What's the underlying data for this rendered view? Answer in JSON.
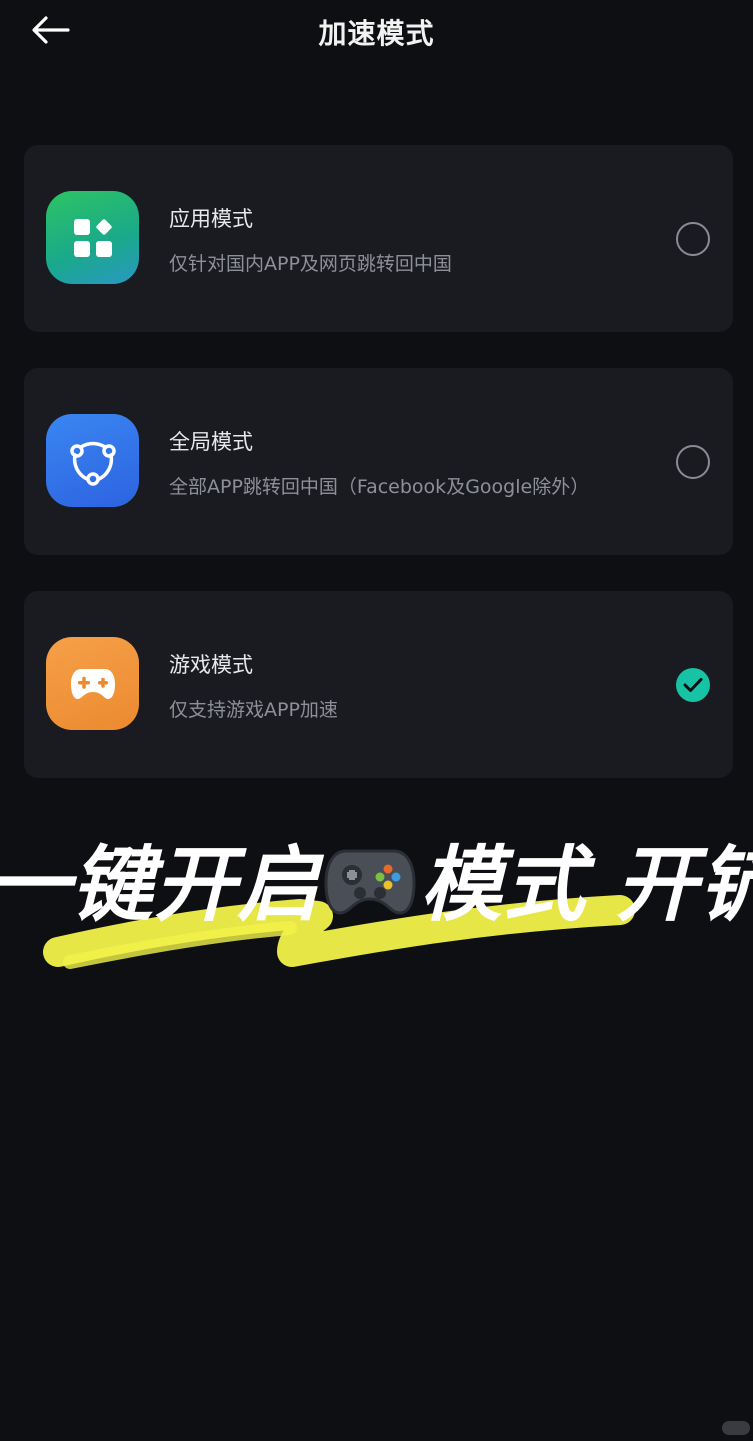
{
  "header": {
    "title": "加速模式",
    "back_icon": "arrow-left-icon"
  },
  "modes": [
    {
      "title": "应用模式",
      "desc": "仅针对国内APP及网页跳转回中国",
      "icon": "apps-grid-icon",
      "icon_color": "#22b573",
      "selected": false
    },
    {
      "title": "全局模式",
      "desc": "全部APP跳转回中国（Facebook及Google除外）",
      "icon": "network-nodes-icon",
      "icon_color": "#2f6fe6",
      "selected": false
    },
    {
      "title": "游戏模式",
      "desc": "仅支持游戏APP加速",
      "icon": "gamepad-icon",
      "icon_color": "#f0953a",
      "selected": true
    }
  ],
  "overlay": {
    "caption_part1": "一键开启",
    "caption_emoji": "gamepad-emoji",
    "caption_part2": "模式 开铲",
    "highlight_color": "#f3f24a"
  },
  "colors": {
    "background": "#0e0f13",
    "card": "#1a1b21",
    "accent": "#17c3a5"
  }
}
